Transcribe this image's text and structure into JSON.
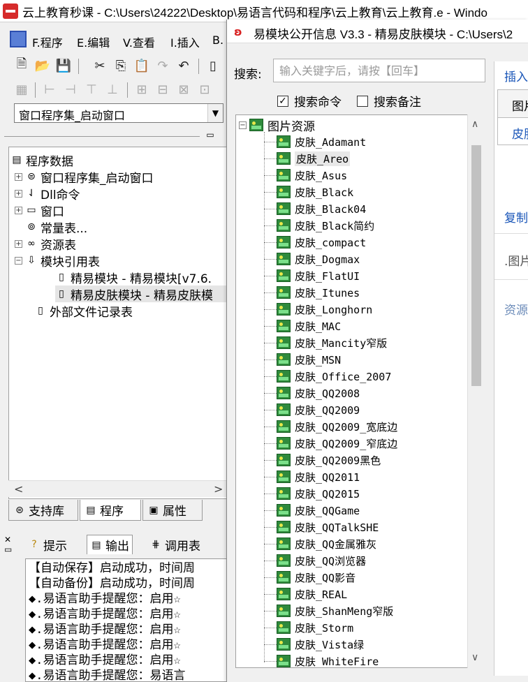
{
  "main_window": {
    "title": "云上教育秒课 - C:\\Users\\24222\\Desktop\\易语言代码和程序\\云上教育\\云上教育.e - Windo"
  },
  "menu": {
    "items": [
      {
        "label": "F.程序"
      },
      {
        "label": "E.编辑"
      },
      {
        "label": "V.查看"
      },
      {
        "label": "I.插入"
      },
      {
        "label": "B."
      }
    ]
  },
  "combo": {
    "value": "窗口程序集_启动窗口"
  },
  "left_tree": {
    "root": "程序数据",
    "items": [
      {
        "label": "窗口程序集_启动窗口",
        "icon": "assembly-icon"
      },
      {
        "label": "Dll命令",
        "icon": "dll-icon"
      },
      {
        "label": "窗口",
        "icon": "window-icon"
      },
      {
        "label": "常量表...",
        "icon": "constant-icon"
      },
      {
        "label": "资源表",
        "icon": "resource-icon"
      },
      {
        "label": "模块引用表",
        "icon": "module-icon"
      },
      {
        "label": "精易模块 - 精易模块[v7.6.",
        "icon": "file-icon"
      },
      {
        "label": "精易皮肤模块 - 精易皮肤模",
        "icon": "file-icon"
      },
      {
        "label": "外部文件记录表",
        "icon": "file-icon"
      }
    ]
  },
  "left_tabs": [
    {
      "label": "支持库"
    },
    {
      "label": "程序"
    },
    {
      "label": "属性"
    }
  ],
  "bottom_tabs": [
    {
      "label": "提示"
    },
    {
      "label": "输出"
    },
    {
      "label": "调用表"
    }
  ],
  "output_lines": [
    "【自动保存】启动成功，时间周",
    "【自动备份】启动成功，时间周",
    "◆.易语言助手提醒您：启用☆",
    "◆.易语言助手提醒您：启用☆",
    "◆.易语言助手提醒您：启用☆",
    "◆.易语言助手提醒您：启用☆",
    "◆.易语言助手提醒您：启用☆",
    "◆.易语言助手提醒您：易语言"
  ],
  "dialog": {
    "title": "易模块公开信息 V3.3 - 精易皮肤模块 - C:\\Users\\2",
    "search_label": "搜索:",
    "search_placeholder": "输入关键字后，请按【回车】",
    "check_commands": {
      "label": "搜索命令",
      "checked": true
    },
    "check_notes": {
      "label": "搜索备注",
      "checked": false
    },
    "tree_root": "图片资源",
    "items": [
      "皮肤_Adamant",
      "皮肤_Areo",
      "皮肤_Asus",
      "皮肤_Black",
      "皮肤_Black04",
      "皮肤_Black简约",
      "皮肤_compact",
      "皮肤_Dogmax",
      "皮肤_FlatUI",
      "皮肤_Itunes",
      "皮肤_Longhorn",
      "皮肤_MAC",
      "皮肤_Mancity窄版",
      "皮肤_MSN",
      "皮肤_Office_2007",
      "皮肤_QQ2008",
      "皮肤_QQ2009",
      "皮肤_QQ2009_宽底边",
      "皮肤_QQ2009_窄底边",
      "皮肤_QQ2009黑色",
      "皮肤_QQ2011",
      "皮肤_QQ2015",
      "皮肤_QQGame",
      "皮肤_QQTalkSHE",
      "皮肤_QQ金属雅灰",
      "皮肤_QQ浏览器",
      "皮肤_QQ影音",
      "皮肤_REAL",
      "皮肤_ShanMeng窄版",
      "皮肤_Storm",
      "皮肤_Vista绿",
      "皮肤_WhiteFire"
    ],
    "selected_index": 1
  },
  "right_panel": {
    "insert_link": "插入",
    "header_cell": "图片",
    "value_cell": "皮肤",
    "copy_link": "复制",
    "pic_text": ".图片",
    "resource_text": "资源"
  }
}
